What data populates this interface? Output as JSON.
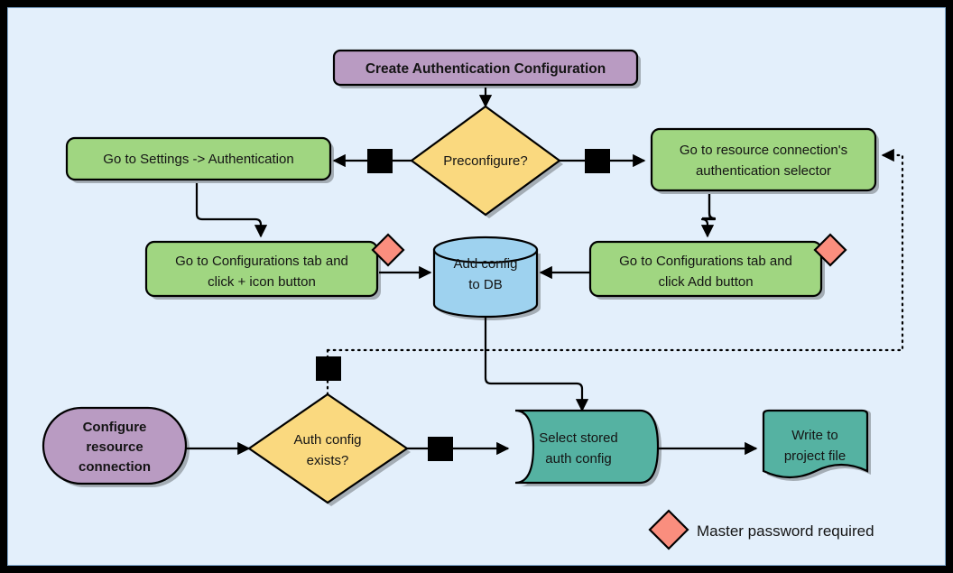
{
  "diagram": {
    "title": "Create Authentication Configuration",
    "background_color": "#e3effb",
    "colors": {
      "purple": "#b99bc2",
      "green": "#a0d681",
      "yellow": "#fad97f",
      "blue": "#9ed2ef",
      "teal": "#55b2a2",
      "salmon": "#fa8e7e",
      "outline": "#000000",
      "text": "#141414"
    }
  },
  "nodes": {
    "create_auth_config": {
      "label": "Create Authentication Configuration",
      "shape": "rounded-rect",
      "color": "#b99bc2"
    },
    "preconfigure": {
      "label": "Preconfigure?",
      "shape": "diamond",
      "color": "#fad97f"
    },
    "go_to_settings": {
      "text_prefix": "Go to ",
      "text_bold": "Settings -> Authentication",
      "shape": "rounded-rect",
      "color": "#a0d681"
    },
    "go_to_resource_connection": {
      "line1": "Go to resource connection's",
      "line2": "authentication selector",
      "shape": "rounded-rect",
      "color": "#a0d681"
    },
    "configurations_plus": {
      "line1_prefix": "Go to ",
      "line1_bold": "Configurations",
      "line1_suffix": " tab and",
      "line2_prefix": "click ",
      "line2_bold": "+",
      "line2_suffix": " icon button",
      "shape": "rounded-rect",
      "color": "#a0d681",
      "badge": "master-password-required"
    },
    "configurations_add": {
      "line1_prefix": "Go to ",
      "line1_bold": "Configurations",
      "line1_suffix": " tab and",
      "line2_prefix": "click ",
      "line2_bold": "Add",
      "line2_suffix": " button",
      "shape": "rounded-rect",
      "color": "#a0d681",
      "badge": "master-password-required"
    },
    "add_config_to_db": {
      "line1": "Add config",
      "line2": "to DB",
      "shape": "cylinder",
      "color": "#9ed2ef"
    },
    "configure_resource_connection": {
      "line1": "Configure",
      "line2": "resource",
      "line3": "connection",
      "shape": "stadium",
      "color": "#b99bc2"
    },
    "auth_config_exists": {
      "line1": "Auth config",
      "line2": "exists?",
      "shape": "diamond",
      "color": "#fad97f"
    },
    "select_stored_auth_config": {
      "line1": "Select stored",
      "line2": "auth config",
      "shape": "subroutine",
      "color": "#55b2a2"
    },
    "write_to_project_file": {
      "line1": "Write to",
      "line2": "project file",
      "shape": "document",
      "color": "#55b2a2"
    }
  },
  "edge_labels": {
    "preconfigure_yes": "",
    "preconfigure_no": "",
    "auth_exists_yes": "",
    "auth_exists_no": ""
  },
  "legend": {
    "symbol": "diamond",
    "symbol_color": "#fa8e7e",
    "label": "Master password required"
  }
}
